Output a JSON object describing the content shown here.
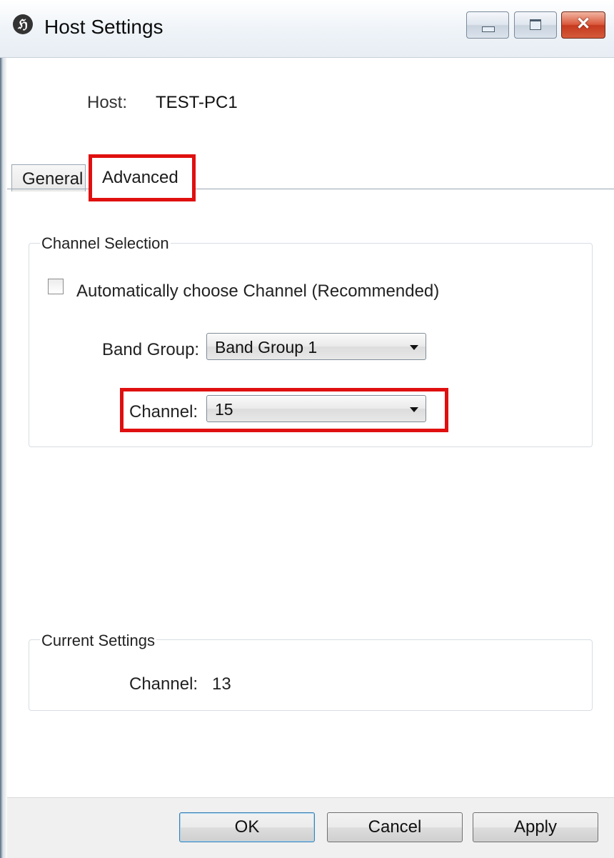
{
  "window": {
    "title": "Host Settings",
    "app_icon_glyph": "ℌ",
    "close_glyph": "✕"
  },
  "host": {
    "label": "Host:",
    "value": "TEST-PC1"
  },
  "tabs": [
    {
      "label": "General",
      "selected": false
    },
    {
      "label": "Advanced",
      "selected": true
    }
  ],
  "channel_selection": {
    "title": "Channel Selection",
    "auto_checkbox": {
      "label": "Automatically choose Channel (Recommended)",
      "checked": false
    },
    "band_group": {
      "label": "Band Group:",
      "value": "Band Group 1"
    },
    "channel": {
      "label": "Channel:",
      "value": "15"
    }
  },
  "current_settings": {
    "title": "Current Settings",
    "channel_label": "Channel:",
    "channel_value": "13"
  },
  "buttons": {
    "ok": "OK",
    "cancel": "Cancel",
    "apply": "Apply"
  },
  "colors": {
    "highlight": "#e01010",
    "close_button": "#c63a1f"
  },
  "icons": [
    "app-icon",
    "minimize-icon",
    "maximize-icon",
    "close-icon",
    "chevron-down-icon"
  ]
}
